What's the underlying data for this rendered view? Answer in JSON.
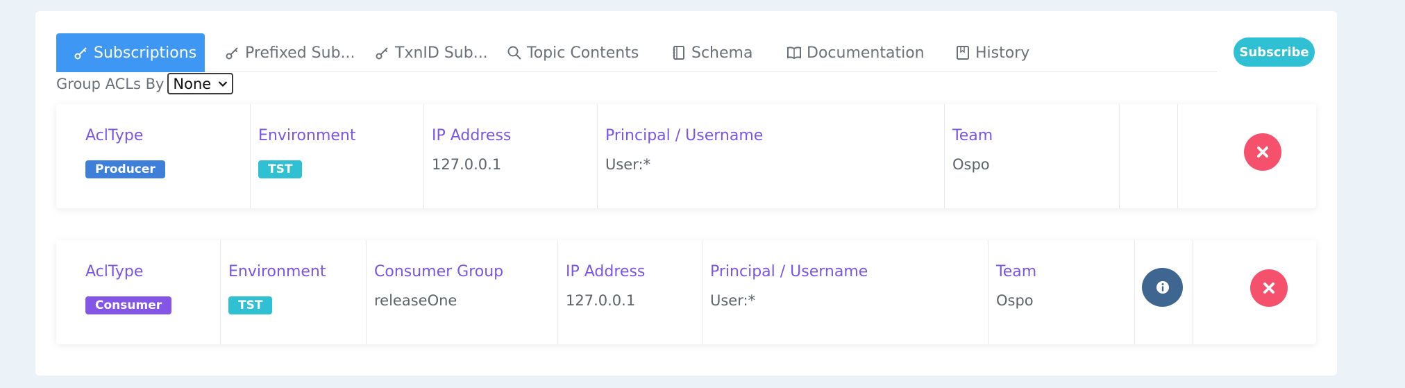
{
  "tabs": [
    {
      "label": "Subscriptions",
      "icon": "key-icon",
      "active": true
    },
    {
      "label": "Prefixed Sub...",
      "icon": "key-icon"
    },
    {
      "label": "TxnID Sub...",
      "icon": "key-icon"
    },
    {
      "label": "Topic Contents",
      "icon": "search-icon"
    },
    {
      "label": "Schema",
      "icon": "notebook-icon"
    },
    {
      "label": "Documentation",
      "icon": "book-icon"
    },
    {
      "label": "History",
      "icon": "bookmark-icon"
    }
  ],
  "subscribe_label": "Subscribe",
  "group_acls": {
    "label": "Group ACLs By",
    "selected": "None"
  },
  "acls": [
    {
      "acl_type": {
        "label": "AclType",
        "value": "Producer"
      },
      "environment": {
        "label": "Environment",
        "value": "TST"
      },
      "ip_address": {
        "label": "IP Address",
        "value": "127.0.0.1"
      },
      "principal": {
        "label": "Principal / Username",
        "value": "User:*"
      },
      "team": {
        "label": "Team",
        "value": "Ospo"
      }
    },
    {
      "acl_type": {
        "label": "AclType",
        "value": "Consumer"
      },
      "environment": {
        "label": "Environment",
        "value": "TST"
      },
      "consumer_group": {
        "label": "Consumer Group",
        "value": "releaseOne"
      },
      "ip_address": {
        "label": "IP Address",
        "value": "127.0.0.1"
      },
      "principal": {
        "label": "Principal / Username",
        "value": "User:*"
      },
      "team": {
        "label": "Team",
        "value": "Ospo"
      }
    }
  ],
  "colors": {
    "active_tab": "#3e97f2",
    "subscribe": "#2fc0d3",
    "label_purple": "#7a55e6",
    "producer_badge": "#3d7fd9",
    "consumer_badge": "#8356e8",
    "env_badge": "#2fc0d3",
    "delete": "#f5516d",
    "info": "#3f6690"
  }
}
